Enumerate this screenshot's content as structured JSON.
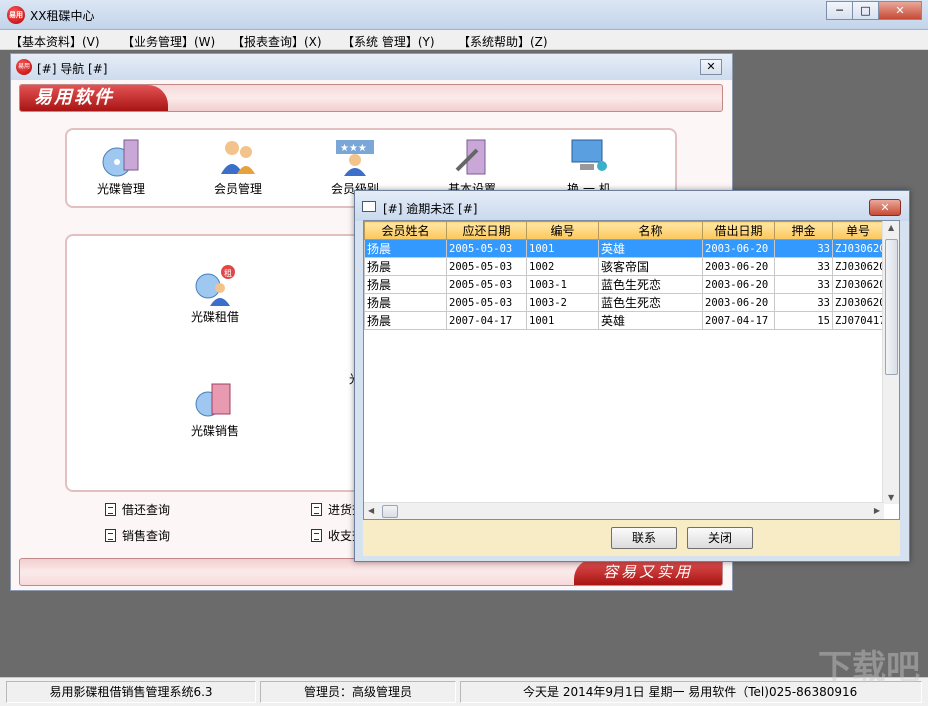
{
  "app": {
    "title": "XX租碟中心",
    "logo_text": "易用"
  },
  "window_controls": {
    "minimize": "─",
    "maximize": "□",
    "close": "✕"
  },
  "menu": [
    "【基本资料】(V)",
    "【业务管理】(W)",
    "【报表查询】(X)",
    "【系统 管理】(Y)",
    "【系统帮助】(Z)"
  ],
  "nav_window": {
    "title": "[#] 导航 [#]",
    "close": "✕",
    "brand": "易用软件",
    "slogan": "容易又实用",
    "top_tiles": [
      "光碟管理",
      "会员管理",
      "会员级别",
      "基本设置",
      "换 一 机"
    ],
    "main_tiles": [
      "光碟租借",
      "光碟销售",
      "光碟"
    ],
    "links": [
      "借还查询",
      "进货查",
      "销售查询",
      "收支查"
    ]
  },
  "overdue_dialog": {
    "title": "[#] 逾期未还 [#]",
    "close": "✕",
    "columns": [
      "会员姓名",
      "应还日期",
      "编号",
      "名称",
      "借出日期",
      "押金",
      "单号"
    ],
    "rows": [
      [
        "扬晨",
        "2005-05-03",
        "1001",
        "英雄",
        "2003-06-20",
        "33",
        "ZJ030620"
      ],
      [
        "扬晨",
        "2005-05-03",
        "1002",
        "骇客帝国",
        "2003-06-20",
        "33",
        "ZJ030620"
      ],
      [
        "扬晨",
        "2005-05-03",
        "1003-1",
        "蓝色生死恋",
        "2003-06-20",
        "33",
        "ZJ030620"
      ],
      [
        "扬晨",
        "2005-05-03",
        "1003-2",
        "蓝色生死恋",
        "2003-06-20",
        "33",
        "ZJ030620"
      ],
      [
        "扬晨",
        "2007-04-17",
        "1001",
        "英雄",
        "2007-04-17",
        "15",
        "ZJ070417"
      ]
    ],
    "selected_row": 0,
    "buttons": {
      "contact": "联系",
      "close": "关闭"
    }
  },
  "status_bar": {
    "system": "易用影碟租借销售管理系统6.3",
    "operator": "管理员：高级管理员",
    "today": "今天是 2014年9月1日   星期一  易用软件（Tel)025-86380916"
  },
  "watermark": "下载吧"
}
